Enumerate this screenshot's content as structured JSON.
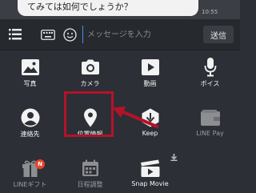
{
  "chat": {
    "message": "てみては如何でしょうか？",
    "time": "10:55"
  },
  "input_bar": {
    "placeholder": "メッセージを入力",
    "send_label": "送信"
  },
  "menu": {
    "items": [
      {
        "label": "写真",
        "icon": "photo-icon"
      },
      {
        "label": "カメラ",
        "icon": "camera-icon"
      },
      {
        "label": "動画",
        "icon": "video-icon"
      },
      {
        "label": "ボイス",
        "icon": "mic-icon"
      },
      {
        "label": "連絡先",
        "icon": "contact-icon"
      },
      {
        "label": "位置情報",
        "icon": "location-pin-icon"
      },
      {
        "label": "Keep",
        "icon": "keep-icon"
      },
      {
        "label": "LINE Pay",
        "icon": "wallet-icon"
      },
      {
        "label": "LINEギフト",
        "icon": "gift-icon",
        "badge": "N"
      },
      {
        "label": "日程調整",
        "icon": "calendar-icon"
      },
      {
        "label": "Snap Movie",
        "icon": "snap-movie-icon"
      }
    ]
  },
  "colors": {
    "background": "#2c2f35",
    "highlight": "#b5122a",
    "badge": "#e8452c"
  }
}
